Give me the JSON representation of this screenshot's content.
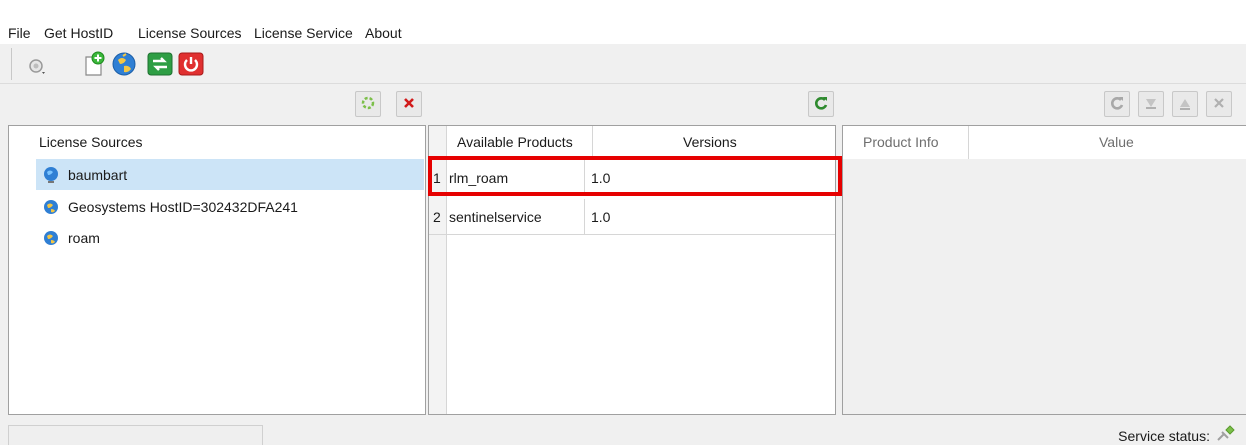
{
  "menu": {
    "items": [
      "File",
      "Get HostID",
      "License Sources",
      "License Service",
      "About"
    ]
  },
  "toolbar": {
    "icons": [
      "search-dropdown-icon",
      "add-document-icon",
      "globe-icon",
      "transfer-icon",
      "power-icon"
    ]
  },
  "sources_panel": {
    "header": "License Sources",
    "items": [
      {
        "label": "baumbart",
        "selected": true
      },
      {
        "label": "Geosystems HostID=302432DFA241",
        "selected": false
      },
      {
        "label": "roam",
        "selected": false
      }
    ]
  },
  "products_panel": {
    "col_products": "Available Products",
    "col_versions": "Versions",
    "rows": [
      {
        "num": "1",
        "product": "rlm_roam",
        "version": "1.0"
      },
      {
        "num": "2",
        "product": "sentinelservice",
        "version": "1.0"
      }
    ]
  },
  "info_panel": {
    "col_info": "Product Info",
    "col_value": "Value"
  },
  "status": {
    "label": "Service status:"
  },
  "colors": {
    "highlight": "#e60000",
    "selection": "#cce4f7"
  }
}
